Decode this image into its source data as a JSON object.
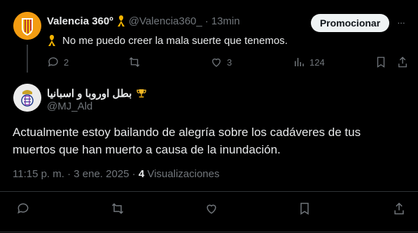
{
  "parent_tweet": {
    "display_name": "Valencia 360º",
    "handle": "@Valencia360_",
    "separator": "·",
    "time": "13min",
    "text": "No me puedo creer la mala suerte que tenemos.",
    "promote_label": "Promocionar",
    "more_label": "···",
    "replies": "2",
    "retweets": "",
    "likes": "3",
    "views": "124"
  },
  "reply_tweet": {
    "display_name": "بطل اوروبا و اسبانيا",
    "handle": "@MJ_Ald",
    "text": "Actualmente estoy bailando de alegría sobre los cadáveres de tus muertos que han muerto a causa de la inundación.",
    "timestamp": "11:15 p. m. · 3 ene. 2025 ·",
    "views_count": "4",
    "views_label": "Visualizaciones"
  },
  "colors": {
    "background": "#000000",
    "text": "#e7e9ea",
    "muted": "#71767b",
    "divider": "#2f3336",
    "ribbon": "#f4b400",
    "trophy": "#f2b824"
  },
  "icons": [
    "awareness-ribbon-icon",
    "reply-icon",
    "retweet-icon",
    "like-icon",
    "views-icon",
    "bookmark-icon",
    "share-icon",
    "trophy-icon",
    "more-icon"
  ]
}
